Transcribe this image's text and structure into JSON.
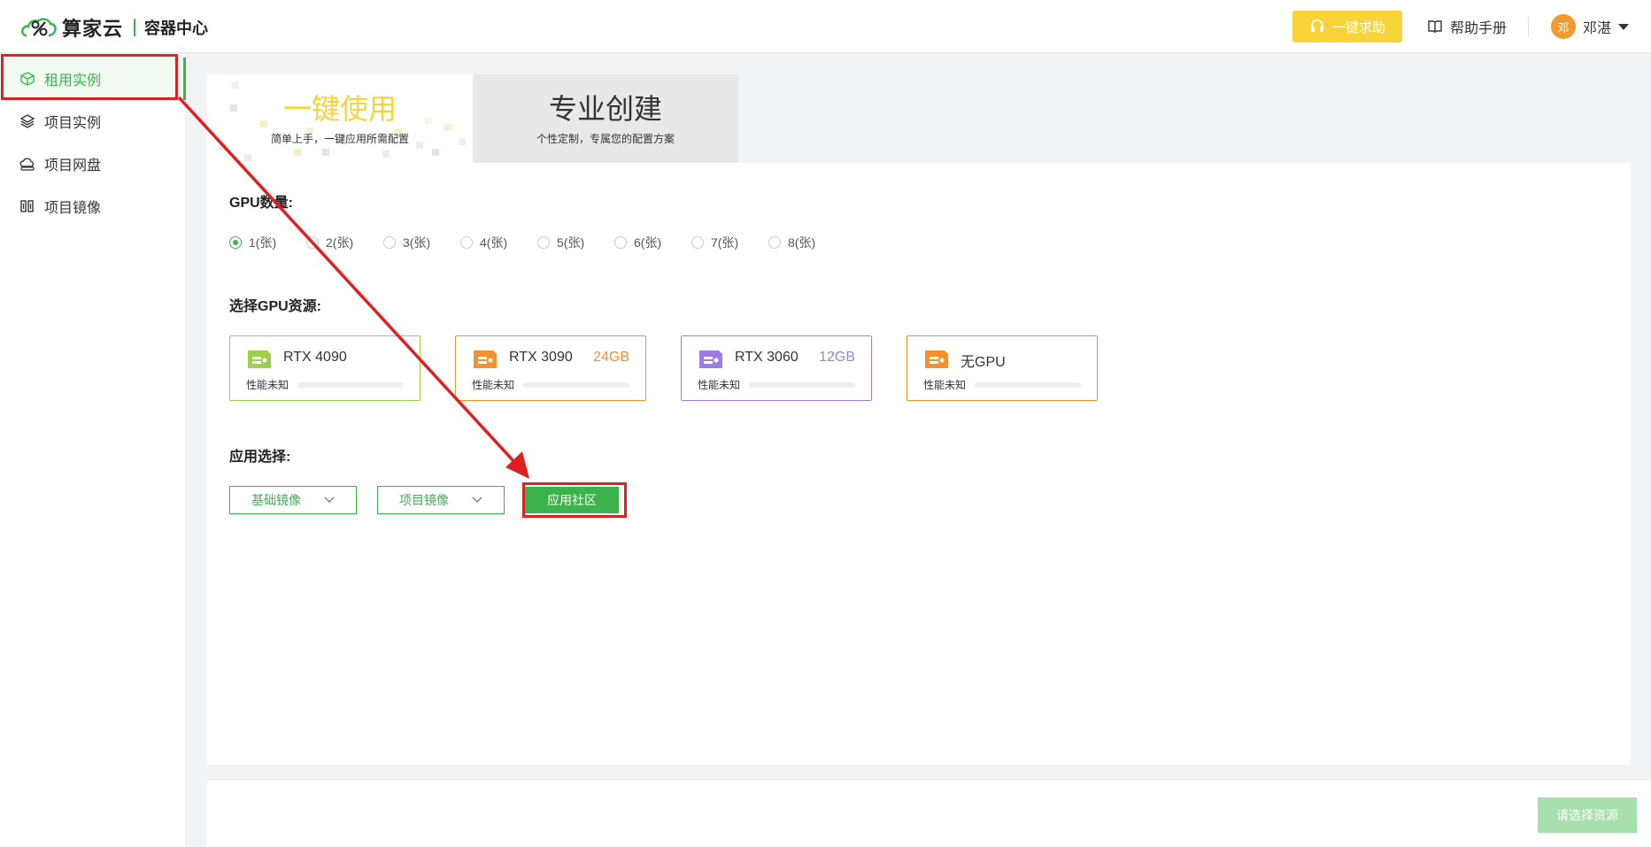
{
  "header": {
    "brand": "算家云",
    "section": "容器中心",
    "help_button": "一键求助",
    "manual": "帮助手册",
    "user_name": "邓湛",
    "avatar_text": "邓"
  },
  "sidebar": {
    "items": [
      {
        "label": "租用实例",
        "icon": "cube-icon",
        "active": true
      },
      {
        "label": "项目实例",
        "icon": "layers-icon",
        "active": false
      },
      {
        "label": "项目网盘",
        "icon": "cloud-disk-icon",
        "active": false
      },
      {
        "label": "项目镜像",
        "icon": "image-icon",
        "active": false
      }
    ]
  },
  "mode_tabs": {
    "one_click": {
      "title": "一键使用",
      "subtitle": "简单上手，一键应用所需配置"
    },
    "pro": {
      "title": "专业创建",
      "subtitle": "个性定制，专属您的配置方案"
    }
  },
  "gpu_count": {
    "label": "GPU数量:",
    "options": [
      "1(张)",
      "2(张)",
      "3(张)",
      "4(张)",
      "5(张)",
      "6(张)",
      "7(张)",
      "8(张)"
    ],
    "selected": "1(张)"
  },
  "gpu_resource": {
    "label": "选择GPU资源:",
    "cards": [
      {
        "name": "RTX 4090",
        "memory": "",
        "perf": "性能未知",
        "color": "#9bd14a"
      },
      {
        "name": "RTX 3090",
        "memory": "24GB",
        "perf": "性能未知",
        "color": "#f5902a"
      },
      {
        "name": "RTX 3060",
        "memory": "12GB",
        "perf": "性能未知",
        "color": "#9a7ce6"
      },
      {
        "name": "无GPU",
        "memory": "",
        "perf": "性能未知",
        "color": "#f5902a"
      }
    ]
  },
  "app_select": {
    "label": "应用选择:",
    "base_image": "基础镜像",
    "project_image": "项目镜像",
    "community": "应用社区"
  },
  "footer": {
    "submit": "请选择资源"
  },
  "colors": {
    "primary": "#3cb34a",
    "accent_yellow": "#f8d43a",
    "annotation": "#e02020"
  }
}
